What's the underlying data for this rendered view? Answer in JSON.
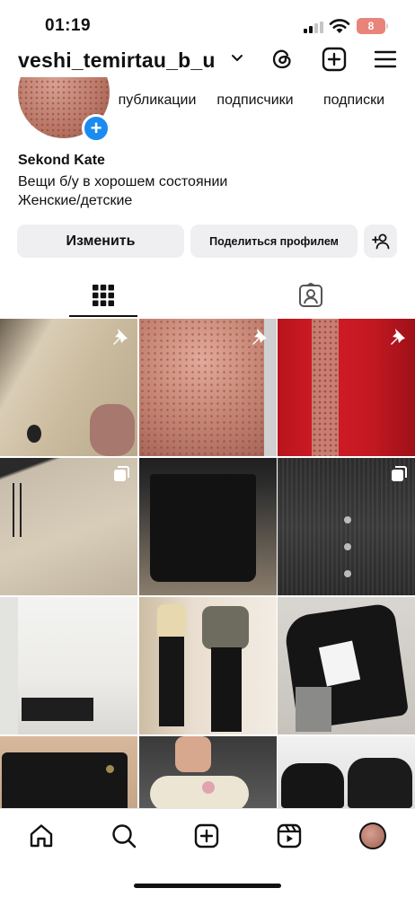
{
  "status_bar": {
    "time": "01:19",
    "battery": "8"
  },
  "header": {
    "username": "veshi_temirtau_b_u",
    "icons": [
      "chevron-down-icon",
      "threads-icon",
      "create-post-icon",
      "menu-icon"
    ]
  },
  "profile": {
    "stats": [
      {
        "label": "публикации"
      },
      {
        "label": "подписчики"
      },
      {
        "label": "подписки"
      }
    ],
    "name": "Sekond Kate",
    "bio": [
      "Вещи б/у в хорошем состоянии",
      "Женские/детские"
    ],
    "buttons": {
      "edit": "Изменить",
      "share": "Поделиться профилем"
    }
  },
  "tabs": [
    {
      "icon": "grid-icon",
      "active": true
    },
    {
      "icon": "tagged-icon",
      "active": false
    }
  ],
  "posts": [
    {
      "subject": "beige coat",
      "badge": "pin-icon"
    },
    {
      "subject": "pink patterned blouse",
      "badge": "pin-icon"
    },
    {
      "subject": "red blazer",
      "badge": "pin-icon"
    },
    {
      "subject": "beige trousers",
      "badge": "multi-photo-icon"
    },
    {
      "subject": "black skirt",
      "badge": ""
    },
    {
      "subject": "black cardigan",
      "badge": "multi-photo-icon"
    },
    {
      "subject": "white blouse",
      "badge": ""
    },
    {
      "subject": "black flared trousers",
      "badge": ""
    },
    {
      "subject": "black hooded jacket",
      "badge": ""
    },
    {
      "subject": "black jeans",
      "badge": ""
    },
    {
      "subject": "kids shoes",
      "badge": ""
    },
    {
      "subject": "black loafers",
      "badge": ""
    }
  ],
  "bottom_nav": [
    "home-icon",
    "search-icon",
    "create-icon",
    "reels-icon",
    "profile-avatar"
  ],
  "colors": {
    "accent_blue": "#1a8cf0",
    "button_bg": "#efeff1",
    "battery_bg": "#e8847a"
  }
}
